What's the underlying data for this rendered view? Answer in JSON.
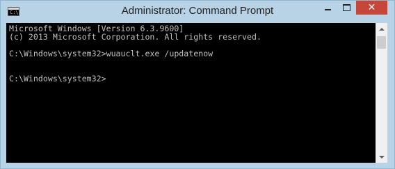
{
  "window": {
    "title": "Administrator: Command Prompt",
    "icon": "cmd-icon",
    "icon_glyph": "C:\\",
    "controls": {
      "minimize": "minimize-icon",
      "maximize": "maximize-icon",
      "close_label": "✕"
    },
    "colors": {
      "titlebar": "#b7d3e5",
      "close": "#c7463a",
      "console_bg": "#000000",
      "console_fg": "#c0c0c0"
    }
  },
  "console": {
    "lines": [
      "Microsoft Windows [Version 6.3.9600]",
      "(c) 2013 Microsoft Corporation. All rights reserved.",
      "",
      "C:\\Windows\\system32>wuauclt.exe /updatenow",
      "",
      "",
      "C:\\Windows\\system32>"
    ]
  },
  "scrollbar": {
    "up_icon": "scroll-up-icon",
    "down_icon": "scroll-down-icon"
  }
}
